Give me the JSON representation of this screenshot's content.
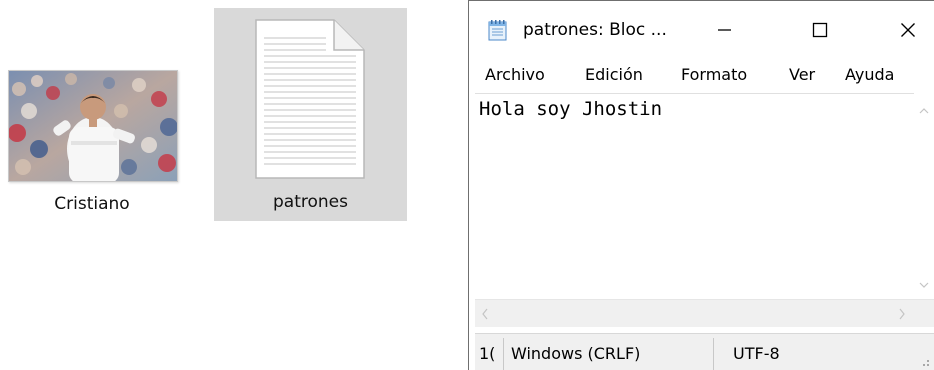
{
  "desktop": {
    "icons": [
      {
        "label": "Cristiano",
        "type": "image"
      },
      {
        "label": "patrones",
        "type": "text-document",
        "selected": true
      }
    ]
  },
  "notepad": {
    "title": "patrones: Bloc ...",
    "icon": "notepad-icon",
    "controls": {
      "minimize_icon": "minimize-icon",
      "maximize_icon": "maximize-icon",
      "close_icon": "close-icon"
    },
    "menu": [
      "Archivo",
      "Edición",
      "Formato",
      "Ver",
      "Ayuda"
    ],
    "content": "Hola soy Jhostin",
    "status": {
      "position": "1(",
      "line_ending": "Windows (CRLF)",
      "encoding": "UTF-8"
    }
  },
  "colors": {
    "selection_bg": "#d9d9d9",
    "statusbar_bg": "#f0f0f0",
    "window_border": "#6f6f6f"
  }
}
